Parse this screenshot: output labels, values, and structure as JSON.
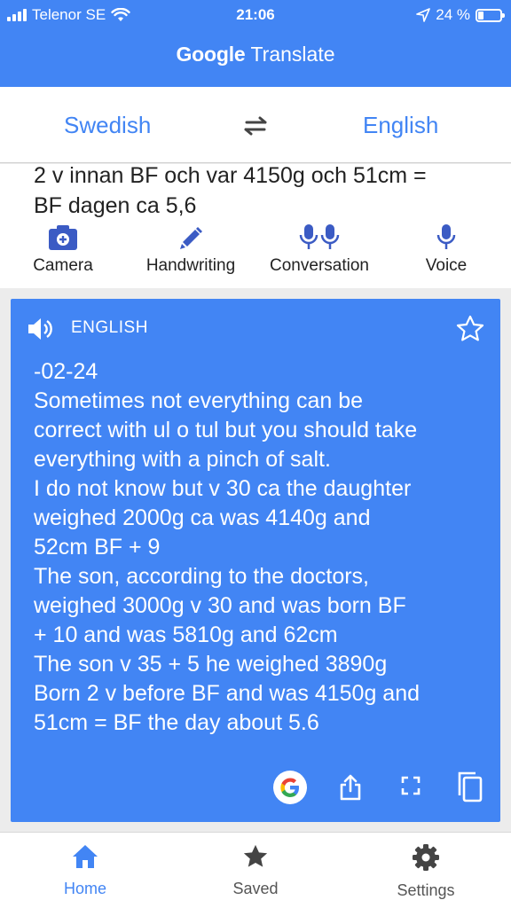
{
  "status": {
    "carrier": "Telenor SE",
    "time": "21:06",
    "battery": "24 %",
    "battery_level": 0.24
  },
  "header": {
    "title_google": "Google",
    "title_app": "Translate"
  },
  "languages": {
    "source": "Swedish",
    "target": "English",
    "swap_icon": "swap-arrows-icon"
  },
  "input": {
    "lines": [
      "2 v innan BF och var 4150g och 51cm =",
      "BF dagen ca 5,6"
    ]
  },
  "tools": [
    {
      "label": "Camera",
      "icon": "camera-icon"
    },
    {
      "label": "Handwriting",
      "icon": "pen-icon"
    },
    {
      "label": "Conversation",
      "icon": "microphones-icon"
    },
    {
      "label": "Voice",
      "icon": "microphone-icon"
    }
  ],
  "translation": {
    "language_label": "ENGLISH",
    "lines": [
      "-02-24",
      "Sometimes not everything can be",
      "correct with ul o tul but you should take",
      "everything with a pinch of salt.",
      "I do not know but v 30 ca the daughter",
      "weighed 2000g ca was 4140g and",
      "52cm BF + 9",
      "The son, according to the doctors,",
      "weighed 3000g v 30 and was born BF",
      "+ 10 and was 5810g and 62cm",
      "The son v 35 + 5 he weighed 3890g",
      "Born 2 v before BF and was 4150g and",
      "51cm = BF the day about 5.6"
    ]
  },
  "nav": [
    {
      "label": "Home",
      "icon": "home-icon",
      "active": true
    },
    {
      "label": "Saved",
      "icon": "star-icon",
      "active": false
    },
    {
      "label": "Settings",
      "icon": "gear-icon",
      "active": false
    }
  ],
  "colors": {
    "accent": "#4285f4",
    "card": "#4285f4",
    "nav_inactive": "#555555"
  }
}
